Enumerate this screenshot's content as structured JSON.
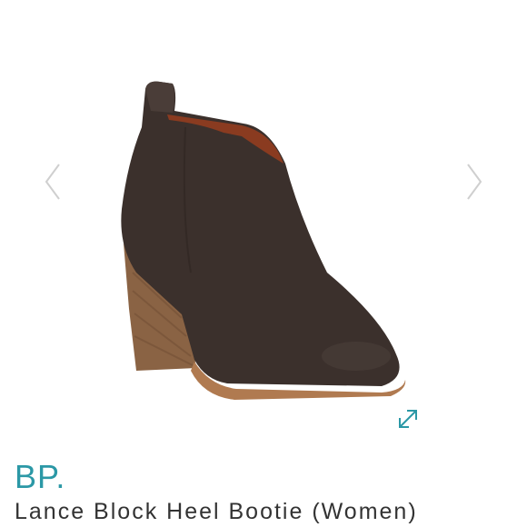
{
  "colors": {
    "accent": "#2b98a6",
    "text": "#333333",
    "arrow": "#cfcfcf",
    "leather": "#3b302c",
    "heel": "#8a6344",
    "lining": "#8a3b20"
  },
  "gallery": {
    "prev_icon": "chevron-left-icon",
    "next_icon": "chevron-right-icon",
    "expand_icon": "expand-icon",
    "image_subject": "ankle-bootie"
  },
  "product": {
    "brand": "BP.",
    "name": "Lance Block Heel Bootie (Women)"
  }
}
